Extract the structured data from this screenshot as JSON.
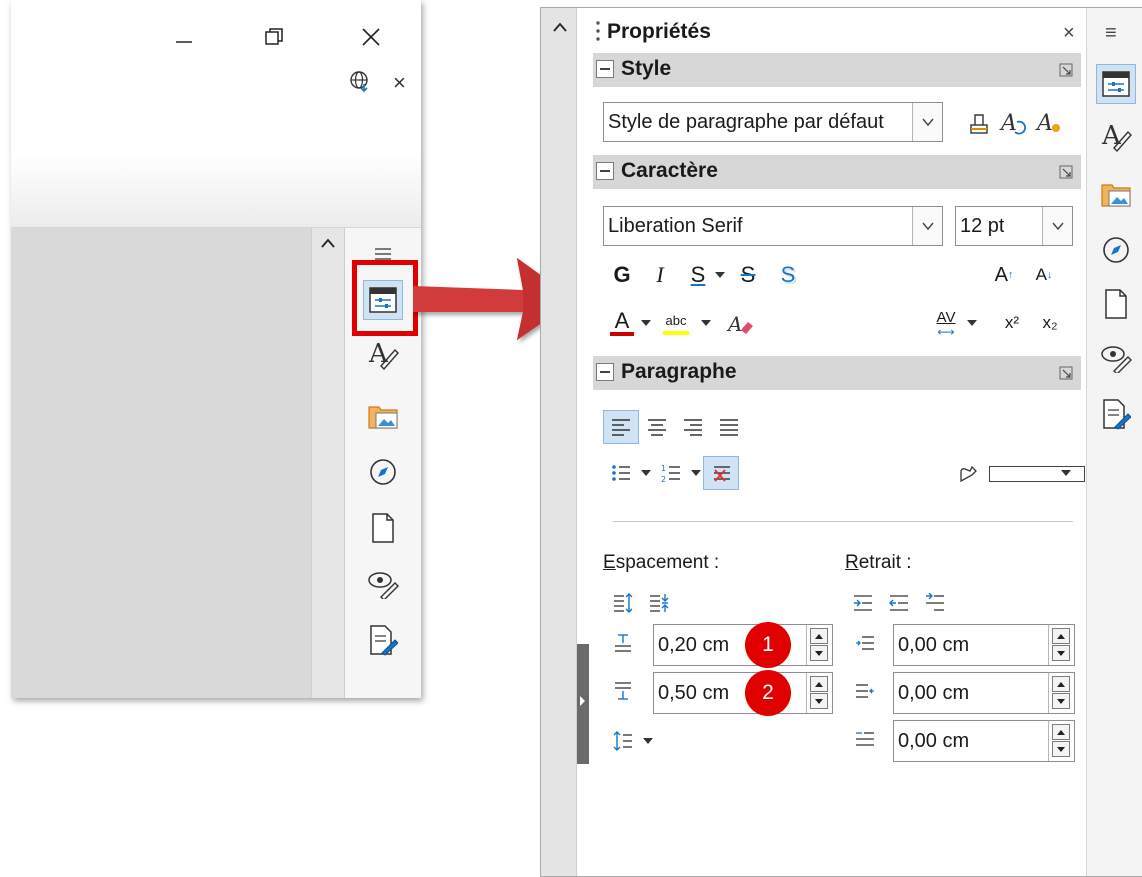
{
  "left_window": {
    "minimize_icon": "minimize-icon",
    "restore_icon": "restore-icon",
    "close_icon": "close-icon",
    "language_icon": "globe-icon",
    "notice_close": "×"
  },
  "properties_panel": {
    "title": "Propriétés",
    "close": "×",
    "menu": "≡",
    "sections": {
      "style": {
        "label": "Style",
        "paragraph_style_value": "Style de paragraphe par défaut"
      },
      "character": {
        "label": "Caractère",
        "font_name": "Liberation Serif",
        "font_size": "12 pt",
        "bold": "G",
        "italic": "I",
        "underline": "S",
        "strike": "S",
        "shadow": "S",
        "grow": "A",
        "shrink": "A",
        "font_color": "A",
        "highlight": "abc",
        "spacing": "AV",
        "superscript": "x²",
        "subscript": "x₂"
      },
      "paragraph": {
        "label": "Paragraphe",
        "spacing_label": "Espacement :",
        "spacing_accel": "E",
        "spacing_rest": "spacement :",
        "indent_label": "Retrait :",
        "indent_accel": "R",
        "indent_rest": "etrait :",
        "above_spacing": "0,20 cm",
        "below_spacing": "0,50 cm",
        "before_indent": "0,00 cm",
        "after_indent": "0,00 cm",
        "first_line_indent": "0,00 cm"
      }
    }
  },
  "callouts": [
    "1",
    "2"
  ],
  "colors": {
    "accent_red": "#e00000",
    "font_color_bar": "#cc0000",
    "highlight_bar": "#ffff00",
    "selected_button": "#cfe3f5",
    "section_header": "#d7d7d7"
  }
}
